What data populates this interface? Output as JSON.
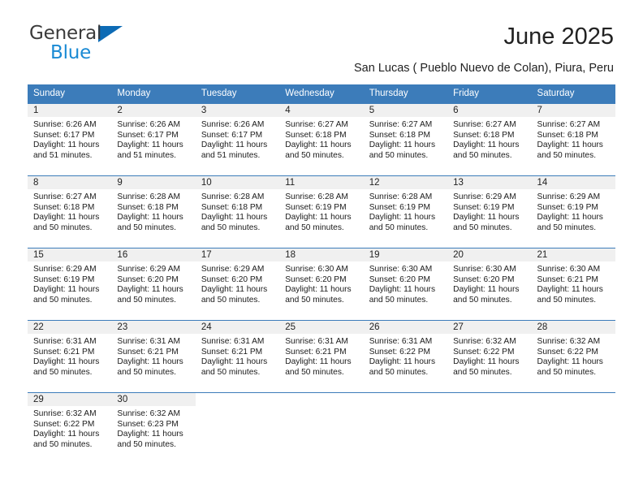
{
  "brand": {
    "word1": "General",
    "word2": "Blue",
    "triangle_color": "#0d6bb5",
    "word2_color": "#1a8ad4"
  },
  "header": {
    "title": "June 2025",
    "subtitle": "San Lucas ( Pueblo Nuevo de Colan), Piura, Peru"
  },
  "theme": {
    "header_blue": "#3c7cba",
    "daynum_band": "#f0f0f0",
    "text": "#222222"
  },
  "calendar": {
    "weekday_headers": [
      "Sunday",
      "Monday",
      "Tuesday",
      "Wednesday",
      "Thursday",
      "Friday",
      "Saturday"
    ],
    "weeks": [
      [
        {
          "day": "1",
          "sunrise": "Sunrise: 6:26 AM",
          "sunset": "Sunset: 6:17 PM",
          "daylight1": "Daylight: 11 hours",
          "daylight2": "and 51 minutes."
        },
        {
          "day": "2",
          "sunrise": "Sunrise: 6:26 AM",
          "sunset": "Sunset: 6:17 PM",
          "daylight1": "Daylight: 11 hours",
          "daylight2": "and 51 minutes."
        },
        {
          "day": "3",
          "sunrise": "Sunrise: 6:26 AM",
          "sunset": "Sunset: 6:17 PM",
          "daylight1": "Daylight: 11 hours",
          "daylight2": "and 51 minutes."
        },
        {
          "day": "4",
          "sunrise": "Sunrise: 6:27 AM",
          "sunset": "Sunset: 6:18 PM",
          "daylight1": "Daylight: 11 hours",
          "daylight2": "and 50 minutes."
        },
        {
          "day": "5",
          "sunrise": "Sunrise: 6:27 AM",
          "sunset": "Sunset: 6:18 PM",
          "daylight1": "Daylight: 11 hours",
          "daylight2": "and 50 minutes."
        },
        {
          "day": "6",
          "sunrise": "Sunrise: 6:27 AM",
          "sunset": "Sunset: 6:18 PM",
          "daylight1": "Daylight: 11 hours",
          "daylight2": "and 50 minutes."
        },
        {
          "day": "7",
          "sunrise": "Sunrise: 6:27 AM",
          "sunset": "Sunset: 6:18 PM",
          "daylight1": "Daylight: 11 hours",
          "daylight2": "and 50 minutes."
        }
      ],
      [
        {
          "day": "8",
          "sunrise": "Sunrise: 6:27 AM",
          "sunset": "Sunset: 6:18 PM",
          "daylight1": "Daylight: 11 hours",
          "daylight2": "and 50 minutes."
        },
        {
          "day": "9",
          "sunrise": "Sunrise: 6:28 AM",
          "sunset": "Sunset: 6:18 PM",
          "daylight1": "Daylight: 11 hours",
          "daylight2": "and 50 minutes."
        },
        {
          "day": "10",
          "sunrise": "Sunrise: 6:28 AM",
          "sunset": "Sunset: 6:18 PM",
          "daylight1": "Daylight: 11 hours",
          "daylight2": "and 50 minutes."
        },
        {
          "day": "11",
          "sunrise": "Sunrise: 6:28 AM",
          "sunset": "Sunset: 6:19 PM",
          "daylight1": "Daylight: 11 hours",
          "daylight2": "and 50 minutes."
        },
        {
          "day": "12",
          "sunrise": "Sunrise: 6:28 AM",
          "sunset": "Sunset: 6:19 PM",
          "daylight1": "Daylight: 11 hours",
          "daylight2": "and 50 minutes."
        },
        {
          "day": "13",
          "sunrise": "Sunrise: 6:29 AM",
          "sunset": "Sunset: 6:19 PM",
          "daylight1": "Daylight: 11 hours",
          "daylight2": "and 50 minutes."
        },
        {
          "day": "14",
          "sunrise": "Sunrise: 6:29 AM",
          "sunset": "Sunset: 6:19 PM",
          "daylight1": "Daylight: 11 hours",
          "daylight2": "and 50 minutes."
        }
      ],
      [
        {
          "day": "15",
          "sunrise": "Sunrise: 6:29 AM",
          "sunset": "Sunset: 6:19 PM",
          "daylight1": "Daylight: 11 hours",
          "daylight2": "and 50 minutes."
        },
        {
          "day": "16",
          "sunrise": "Sunrise: 6:29 AM",
          "sunset": "Sunset: 6:20 PM",
          "daylight1": "Daylight: 11 hours",
          "daylight2": "and 50 minutes."
        },
        {
          "day": "17",
          "sunrise": "Sunrise: 6:29 AM",
          "sunset": "Sunset: 6:20 PM",
          "daylight1": "Daylight: 11 hours",
          "daylight2": "and 50 minutes."
        },
        {
          "day": "18",
          "sunrise": "Sunrise: 6:30 AM",
          "sunset": "Sunset: 6:20 PM",
          "daylight1": "Daylight: 11 hours",
          "daylight2": "and 50 minutes."
        },
        {
          "day": "19",
          "sunrise": "Sunrise: 6:30 AM",
          "sunset": "Sunset: 6:20 PM",
          "daylight1": "Daylight: 11 hours",
          "daylight2": "and 50 minutes."
        },
        {
          "day": "20",
          "sunrise": "Sunrise: 6:30 AM",
          "sunset": "Sunset: 6:20 PM",
          "daylight1": "Daylight: 11 hours",
          "daylight2": "and 50 minutes."
        },
        {
          "day": "21",
          "sunrise": "Sunrise: 6:30 AM",
          "sunset": "Sunset: 6:21 PM",
          "daylight1": "Daylight: 11 hours",
          "daylight2": "and 50 minutes."
        }
      ],
      [
        {
          "day": "22",
          "sunrise": "Sunrise: 6:31 AM",
          "sunset": "Sunset: 6:21 PM",
          "daylight1": "Daylight: 11 hours",
          "daylight2": "and 50 minutes."
        },
        {
          "day": "23",
          "sunrise": "Sunrise: 6:31 AM",
          "sunset": "Sunset: 6:21 PM",
          "daylight1": "Daylight: 11 hours",
          "daylight2": "and 50 minutes."
        },
        {
          "day": "24",
          "sunrise": "Sunrise: 6:31 AM",
          "sunset": "Sunset: 6:21 PM",
          "daylight1": "Daylight: 11 hours",
          "daylight2": "and 50 minutes."
        },
        {
          "day": "25",
          "sunrise": "Sunrise: 6:31 AM",
          "sunset": "Sunset: 6:21 PM",
          "daylight1": "Daylight: 11 hours",
          "daylight2": "and 50 minutes."
        },
        {
          "day": "26",
          "sunrise": "Sunrise: 6:31 AM",
          "sunset": "Sunset: 6:22 PM",
          "daylight1": "Daylight: 11 hours",
          "daylight2": "and 50 minutes."
        },
        {
          "day": "27",
          "sunrise": "Sunrise: 6:32 AM",
          "sunset": "Sunset: 6:22 PM",
          "daylight1": "Daylight: 11 hours",
          "daylight2": "and 50 minutes."
        },
        {
          "day": "28",
          "sunrise": "Sunrise: 6:32 AM",
          "sunset": "Sunset: 6:22 PM",
          "daylight1": "Daylight: 11 hours",
          "daylight2": "and 50 minutes."
        }
      ],
      [
        {
          "day": "29",
          "sunrise": "Sunrise: 6:32 AM",
          "sunset": "Sunset: 6:22 PM",
          "daylight1": "Daylight: 11 hours",
          "daylight2": "and 50 minutes."
        },
        {
          "day": "30",
          "sunrise": "Sunrise: 6:32 AM",
          "sunset": "Sunset: 6:23 PM",
          "daylight1": "Daylight: 11 hours",
          "daylight2": "and 50 minutes."
        },
        null,
        null,
        null,
        null,
        null
      ]
    ]
  }
}
